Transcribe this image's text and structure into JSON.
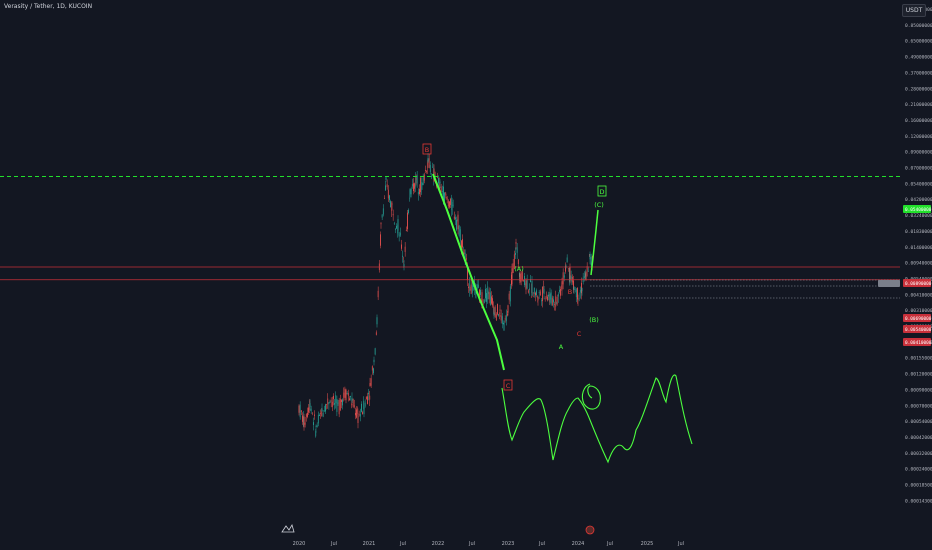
{
  "header": {
    "title": "Verasity / Tether, 1D, KUCOIN",
    "currency": "USDT"
  },
  "colors": {
    "background": "#131722",
    "up": "#26a69a",
    "down": "#ef5350",
    "wave_red": "#e53935",
    "wave_green": "#4cff3f",
    "hline_red": "#c8303a",
    "target_green": "#22e02b",
    "axis_text": "#b2b5be"
  },
  "chart_data": {
    "type": "candlestick",
    "symbol": "VRA/USDT",
    "exchange": "KUCOIN",
    "interval": "1D",
    "scale": "log",
    "yaxis_ticks": [
      "1.40000000",
      "0.85000000",
      "0.65000000",
      "0.49000000",
      "0.37000000",
      "0.28000000",
      "0.21000000",
      "0.16000000",
      "0.12000000",
      "0.09000000",
      "0.07000000",
      "0.05400000",
      "0.04200000",
      "0.03240000",
      "0.01830000",
      "0.01400000",
      "0.00940000",
      "0.00540000",
      "0.00410000",
      "0.00310000",
      "0.00260000",
      "0.00200000",
      "0.00155000",
      "0.00120000",
      "0.00090000",
      "0.00070000",
      "0.00054000",
      "0.00042000",
      "0.00032000",
      "0.00024000",
      "0.00018500",
      "0.00014300"
    ],
    "xaxis_ticks": [
      "2020",
      "Jul",
      "2021",
      "Jul",
      "2022",
      "Jul",
      "2023",
      "Jul",
      "2024",
      "Jul",
      "2025",
      "Jul"
    ],
    "price_labels": [
      {
        "text": "0.05400000",
        "color": "#22e02b"
      },
      {
        "text": "0.00890000",
        "color": "#c8303a"
      },
      {
        "text": "0.00690000",
        "color": "#c8303a"
      },
      {
        "text": "0.00540000",
        "color": "#c8303a"
      },
      {
        "text": "0.00410000",
        "color": "#c8303a"
      }
    ],
    "horizontal_levels": [
      {
        "price": 0.0542,
        "style": "dashed",
        "color": "#22e02b"
      },
      {
        "price": 0.0089,
        "style": "solid",
        "color": "#c8303a"
      },
      {
        "price": 0.0069,
        "style": "solid",
        "color": "#c8303a"
      }
    ],
    "wave_labels": [
      {
        "text": "B",
        "color": "#e53935",
        "boxed": true
      },
      {
        "text": "C",
        "color": "#e53935",
        "boxed": true
      },
      {
        "text": "(A)",
        "color": "#4cff3f",
        "boxed": false
      },
      {
        "text": "A",
        "color": "#4cff3f",
        "boxed": false
      },
      {
        "text": "B",
        "color": "#e53935",
        "boxed": false
      },
      {
        "text": "C",
        "color": "#e53935",
        "boxed": false
      },
      {
        "text": "(B)",
        "color": "#4cff3f",
        "boxed": false
      },
      {
        "text": "(C)",
        "color": "#4cff3f",
        "boxed": false
      },
      {
        "text": "D",
        "color": "#4cff3f",
        "boxed": true
      }
    ]
  }
}
